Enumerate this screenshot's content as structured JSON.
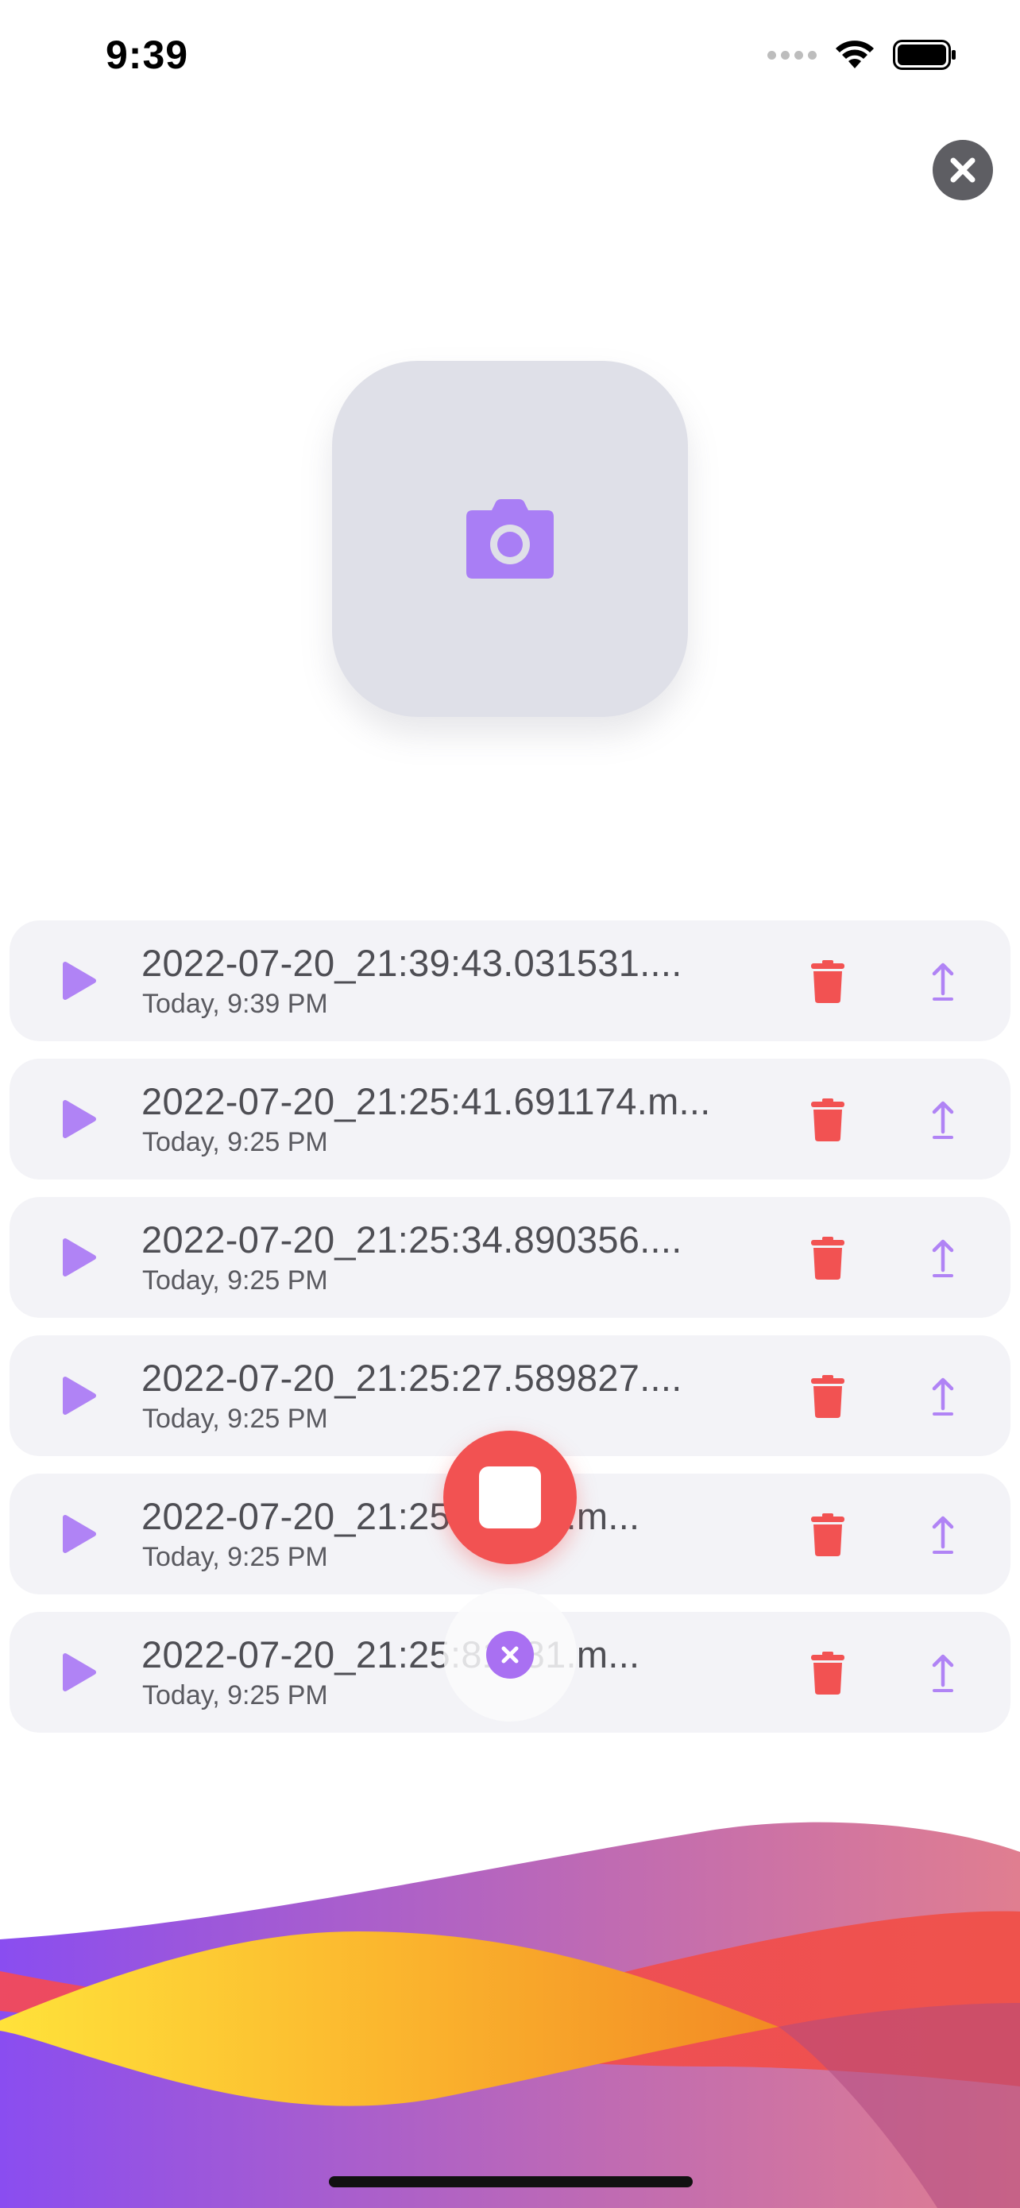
{
  "status_bar": {
    "time": "9:39",
    "signal_icon": "signal-dots-icon",
    "wifi_icon": "wifi-icon",
    "battery_icon": "battery-icon"
  },
  "header": {
    "close_icon": "close-icon"
  },
  "camera": {
    "icon": "camera-icon",
    "color": "#a97ef5"
  },
  "recordings": [
    {
      "title": "2022-07-20_21:39:43.031531....",
      "subtitle": "Today, 9:39 PM"
    },
    {
      "title": "2022-07-20_21:25:41.691174.m...",
      "subtitle": "Today, 9:25 PM"
    },
    {
      "title": "2022-07-20_21:25:34.890356....",
      "subtitle": "Today, 9:25 PM"
    },
    {
      "title": "2022-07-20_21:25:27.589827....",
      "subtitle": "Today, 9:25 PM"
    },
    {
      "title": "2022-07-20_21:25:24176.m...",
      "subtitle": "Today, 9:25 PM"
    },
    {
      "title": "2022-07-20_21:25:81381.m...",
      "subtitle": "Today, 9:25 PM"
    }
  ],
  "controls": {
    "stop_icon": "stop-icon",
    "cancel_icon": "cancel-icon",
    "stop_color": "#f25252",
    "accent": "#a970f2"
  },
  "colors": {
    "play": "#b083f5",
    "trash": "#f25252",
    "upload": "#b083f5"
  }
}
